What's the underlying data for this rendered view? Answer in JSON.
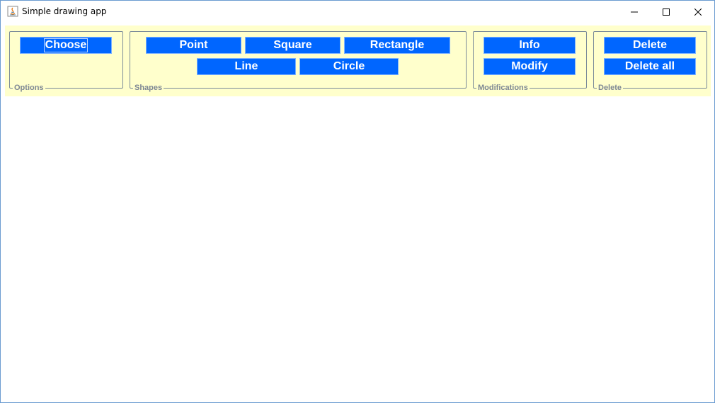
{
  "window": {
    "title": "Simple drawing app",
    "app_icon": "java-icon",
    "controls": {
      "minimize": "minimize-icon",
      "maximize": "maximize-icon",
      "close": "close-icon"
    }
  },
  "colors": {
    "toolbar_bg": "#ffffcc",
    "button_bg": "#0066ff",
    "button_text": "#ffffff",
    "legend_text": "#7d8793",
    "group_border": "#7a8a99"
  },
  "groups": {
    "options": {
      "legend": "Options",
      "buttons": {
        "choose": "Choose"
      }
    },
    "shapes": {
      "legend": "Shapes",
      "buttons": {
        "point": "Point",
        "square": "Square",
        "rectangle": "Rectangle",
        "line": "Line",
        "circle": "Circle"
      }
    },
    "modifications": {
      "legend": "Modifications",
      "buttons": {
        "info": "Info",
        "modify": "Modify"
      }
    },
    "delete": {
      "legend": "Delete",
      "buttons": {
        "delete": "Delete",
        "delete_all": "Delete all"
      }
    }
  }
}
